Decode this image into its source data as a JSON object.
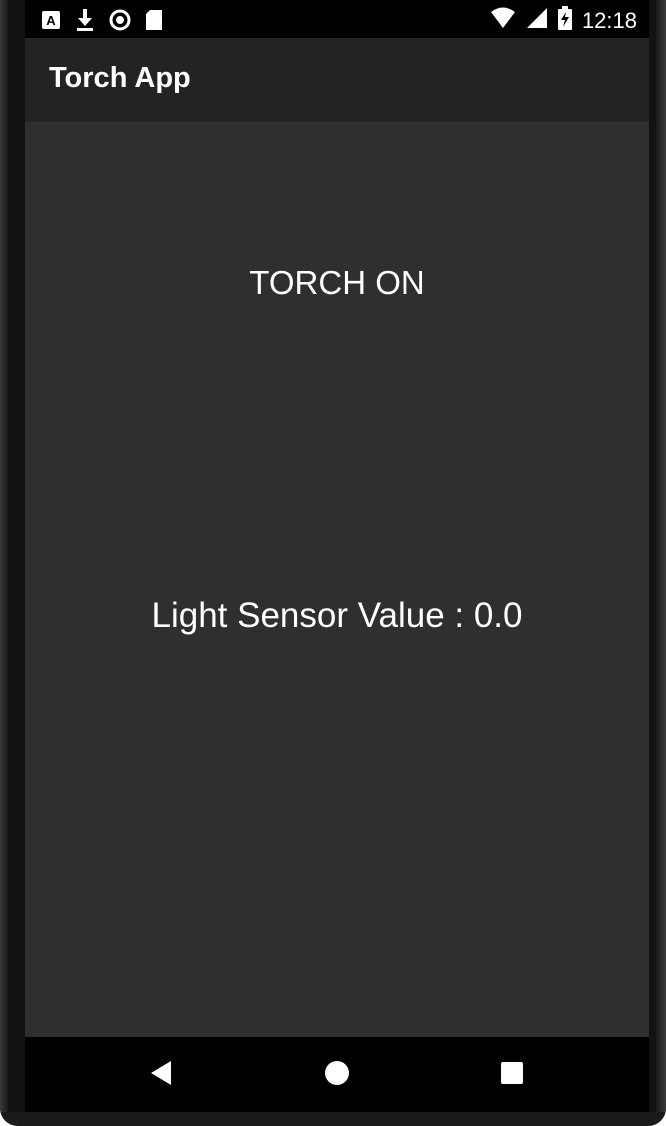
{
  "status_bar": {
    "time": "12:18",
    "left_icons": [
      "app-notification-icon",
      "download-icon",
      "sync-icon",
      "sd-card-icon"
    ],
    "right_icons": [
      "wifi-icon",
      "cell-signal-icon",
      "battery-charging-icon"
    ]
  },
  "app_bar": {
    "title": "Torch App"
  },
  "main": {
    "torch_button_label": "TORCH ON",
    "sensor_label": "Light Sensor Value : 0.0"
  },
  "nav_bar": {
    "buttons": [
      "back-icon",
      "home-icon",
      "recents-icon"
    ]
  },
  "colors": {
    "background": "#2f2f2f",
    "app_bar": "#232323",
    "text": "#ffffff",
    "system_bars": "#000000"
  }
}
